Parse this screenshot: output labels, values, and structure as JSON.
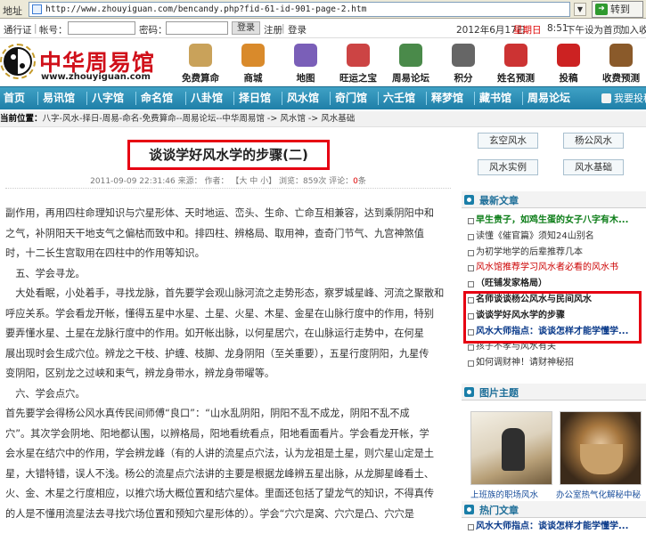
{
  "browser": {
    "address_label": "地址",
    "url": "http://www.zhouyiguan.com/bencandy.php?fid-61-id-901-page-2.htm",
    "go_label": "转到"
  },
  "login_bar": {
    "passport": "通行证",
    "account_label": "帐号：",
    "password_label": "密码：",
    "login_button": "登录",
    "register": "注册",
    "separator": "|",
    "login_link": "登录",
    "date": "2012年6月17日",
    "weekday": "星期日",
    "time": "8:51",
    "ampm": "下午",
    "set_home": "设为首页",
    "favorite": "加入收藏"
  },
  "header": {
    "site_name": "中华周易馆",
    "domain": "www.zhouyiguan.com",
    "icons": [
      {
        "label": "免费算命",
        "icon": "fortune-icon",
        "color": "#c9a25a"
      },
      {
        "label": "商城",
        "icon": "mall-icon",
        "color": "#d98a2b"
      },
      {
        "label": "地图",
        "icon": "map-icon",
        "color": "#7a5fb8"
      },
      {
        "label": "旺运之宝",
        "icon": "treasure-icon",
        "color": "#c44"
      },
      {
        "label": "周易论坛",
        "icon": "forum-icon",
        "color": "#4a8a4a"
      },
      {
        "label": "积分",
        "icon": "points-icon",
        "color": "#666"
      },
      {
        "label": "姓名预测",
        "icon": "name-predict-icon",
        "color": "#c33"
      },
      {
        "label": "投稿",
        "icon": "submit-icon",
        "color": "#c22"
      },
      {
        "label": "收费预测",
        "icon": "paid-predict-icon",
        "color": "#8a5a2a"
      }
    ]
  },
  "nav": {
    "items": [
      "首页",
      "易讯馆",
      "八字馆",
      "命名馆",
      "八卦馆",
      "择日馆",
      "风水馆",
      "奇门馆",
      "六壬馆",
      "释梦馆",
      "藏书馆",
      "周易论坛"
    ],
    "post": "我要投稿"
  },
  "breadcrumb": {
    "prefix": "当前位置：",
    "path": "八字-风水-择日-周易-命名-免费算命--周易论坛--中华周易馆",
    "level1": "风水馆",
    "level2": "风水基础",
    "arrow": "->"
  },
  "article": {
    "title": "谈谈学好风水学的步骤(二)",
    "date": "2011-09-09 22:31:46",
    "source_label": "来源：",
    "author_label": "作者：",
    "font_size": "【大 中 小】",
    "views_label": "浏览：",
    "views": "859次",
    "comments_label": "评论：",
    "comments": "0",
    "comments_unit": "条",
    "paragraphs": [
      "副作用，再用四柱命理知识与穴星形体、天时地运、峦头、生命、亡命互相兼容，达到乘阴阳中和",
      "之气，补阴阳天干地支气之偏枯而致中和。排四柱、辨格局、取用神，查奇门节气、九宫神煞值",
      "时，十二长生宫取用在四柱中的作用等知识。",
      "　五、学会寻龙。",
      "　大处看眠，小处着手，寻找龙脉，首先要学会观山脉河流之走势形态，察罗城星峰、河流之聚散和",
      "呼应关系。学会看龙开帐，懂得五星中水星、土星、火星、木星、金星在山脉行度中的作用，特别",
      "要弄懂水星、土星在龙脉行度中的作用。如开帐出脉，以何星居穴，在山脉运行走势中，在何星",
      "展出现时会生成穴位。辨龙之干枝、护缠、枝脚、龙身阴阳（至关重要），五星行度阴阳，九星传",
      "变阴阳，区别龙之过峡和束气，辨龙身带水，辨龙身带曜等。",
      "　六、学会点穴。",
      "首先要学会得杨公风水真传民间师傅“良口”：“山水乱阴阳，阴阳不乱不成龙，阴阳不乱不成",
      "穴”。其次学会阴地、阳地都认围，以辨格局，阳地看统看点，阳地看面看片。学会看龙开帐，学",
      "会水星在结穴中的作用，学会辨龙峰（有的人讲的流星点穴法，认为龙祖是土星，则穴星山定是土",
      "星，大错特错，误人不浅。杨公的流星点穴法讲的主要是根据龙峰辨五星出脉，从龙脚星峰看土、",
      "火、金、木星之行度相应，以推穴场大概位置和结穴星体。里面还包括了望龙气的知识，不得真传",
      "的人是不懂用流星法去寻找穴场位置和预知穴星形体的）。学会“穴穴是窝、穴穴是凸、穴穴是"
    ]
  },
  "sidebar": {
    "categories": [
      "玄空风水",
      "杨公风水",
      "风水实例",
      "风水基础"
    ],
    "latest_title": "最新文章",
    "latest": [
      "早生贵子，如鸡生蛋的女子八字有木...",
      "读懂《催官篇》须知24山别名",
      "为初学地学的后辈推荐几本",
      "风水馆推荐学习风水者必看的风水书",
      "（旺铺发家格局）",
      "名师谈谈杨公风水与民间风水",
      "谈谈学好风水学的步骤",
      "风水大师指点：谈谈怎样才能学懂学...",
      "孩子不孝与风水有关",
      "如何调财神！请财神秘招"
    ],
    "photo_title": "图片主题",
    "photos": [
      {
        "caption": "上班族的职场风水"
      },
      {
        "caption": "办公室热气化解秘中秘"
      }
    ],
    "hot_title": "热门文章",
    "hot": [
      "风水大师指点：谈谈怎样才能学懂学..."
    ]
  }
}
